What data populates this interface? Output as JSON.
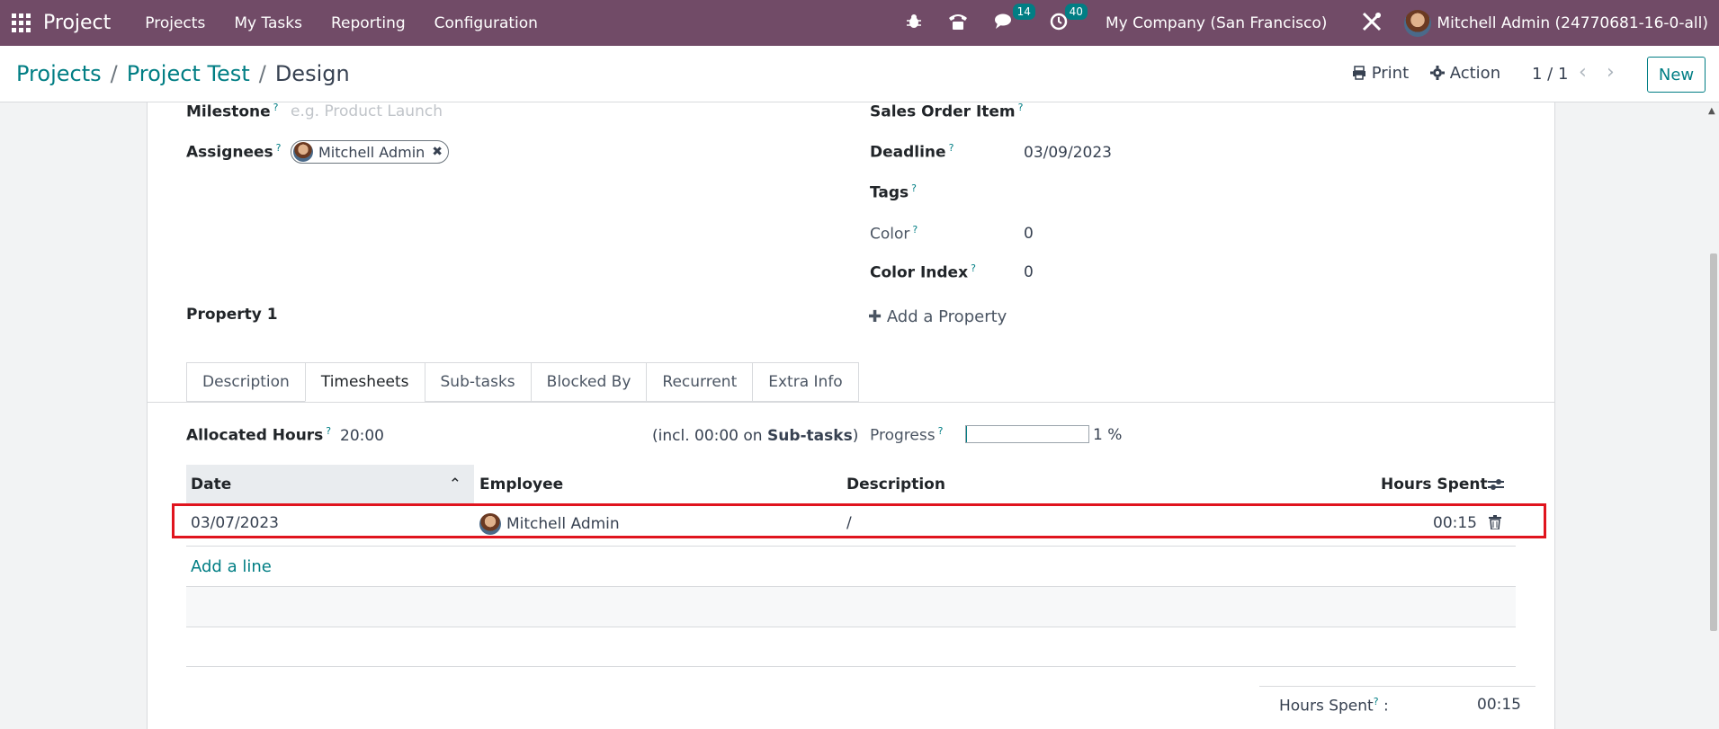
{
  "navbar": {
    "brand": "Project",
    "menus": [
      "Projects",
      "My Tasks",
      "Reporting",
      "Configuration"
    ],
    "chat_badge": "14",
    "activity_badge": "40",
    "company": "My Company (San Francisco)",
    "user": "Mitchell Admin (24770681-16-0-all)",
    "color": "#714b67"
  },
  "control": {
    "breadcrumb": [
      "Projects",
      "Project Test",
      "Design"
    ],
    "print": "Print",
    "action": "Action",
    "pager": "1 / 1",
    "new": "New"
  },
  "form": {
    "milestone_label": "Milestone",
    "milestone_placeholder": "e.g. Product Launch",
    "assignees_label": "Assignees",
    "assignee": "Mitchell Admin",
    "sales_order_item_label": "Sales Order Item",
    "deadline_label": "Deadline",
    "deadline": "03/09/2023",
    "tags_label": "Tags",
    "color_label": "Color",
    "color": "0",
    "color_index_label": "Color Index",
    "color_index": "0",
    "property_label": "Property 1",
    "add_property": "Add a Property",
    "help_mark": "?"
  },
  "tabs": [
    "Description",
    "Timesheets",
    "Sub-tasks",
    "Blocked By",
    "Recurrent",
    "Extra Info"
  ],
  "timesheets": {
    "allocated_label": "Allocated Hours",
    "allocated": "20:00",
    "incl_prefix": "(incl. 00:00 on",
    "incl_bold": "Sub-tasks",
    "incl_suffix": ")",
    "progress_label": "Progress",
    "progress_text": "1 %",
    "progress_value": 1,
    "columns": [
      "Date",
      "Employee",
      "Description",
      "Hours Spent"
    ],
    "rows": [
      {
        "date": "03/07/2023",
        "employee": "Mitchell Admin",
        "description": "/",
        "hours": "00:15"
      }
    ],
    "add_line": "Add a line",
    "total_label": "Hours Spent",
    "total_value": "00:15"
  },
  "colors": {
    "accent": "#017e84",
    "highlight": "#e0141e"
  }
}
